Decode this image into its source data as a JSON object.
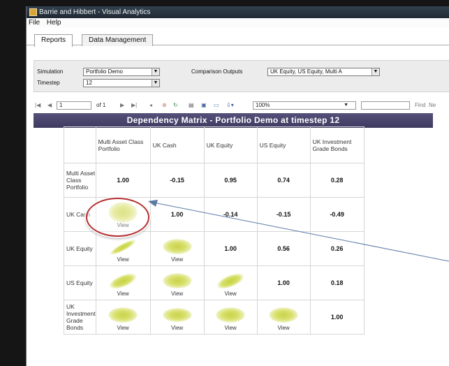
{
  "window": {
    "title": "Barrie and Hibbert - Visual Analytics"
  },
  "menu": [
    "File",
    "Help"
  ],
  "tabs": [
    {
      "label": "Reports",
      "active": true
    },
    {
      "label": "Data Management",
      "active": false
    }
  ],
  "params": {
    "simulation_label": "Simulation",
    "simulation_value": "Portfolio Demo",
    "timestep_label": "Timestep",
    "timestep_value": "12",
    "comparison_label": "Comparison Outputs",
    "comparison_value": "UK Equity, US Equity, Multi A"
  },
  "toolbar": {
    "page_value": "1",
    "page_of": "of 1",
    "zoom": "100%",
    "find_label": "Find",
    "next_label": "Ne"
  },
  "report": {
    "title": "Dependency Matrix - Portfolio Demo at timestep 12",
    "columns": [
      "Multi Asset Class Portfolio",
      "UK Cash",
      "UK Equity",
      "US Equity",
      "UK Investment Grade Bonds"
    ],
    "view_label": "View",
    "rows": [
      {
        "name": "Multi Asset Class Portfolio",
        "values": [
          "1.00",
          "-0.15",
          "0.95",
          "0.74",
          "0.28"
        ]
      },
      {
        "name": "UK Cash",
        "values": [
          "",
          "1.00",
          "-0.14",
          "-0.15",
          "-0.49"
        ]
      },
      {
        "name": "UK Equity",
        "values": [
          "",
          "",
          "1.00",
          "0.56",
          "0.26"
        ]
      },
      {
        "name": "US Equity",
        "values": [
          "",
          "",
          "",
          "1.00",
          "0.18"
        ]
      },
      {
        "name": "UK Investment Grade Bonds",
        "values": [
          "",
          "",
          "",
          "",
          "1.00"
        ]
      }
    ]
  },
  "colors": {
    "header_bg": "#4a4670",
    "scatter_points": "#c8d34a",
    "highlight_ring": "#b52d2d",
    "arrow": "#5a7aa6"
  }
}
